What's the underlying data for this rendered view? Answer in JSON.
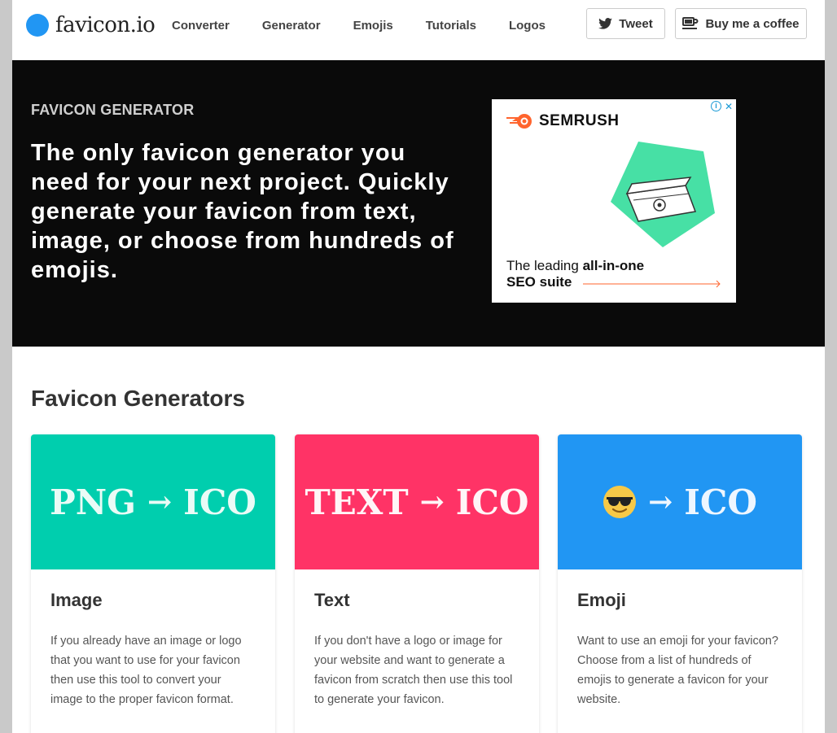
{
  "nav": {
    "logo_text": "favicon.io",
    "links": [
      "Converter",
      "Generator",
      "Emojis",
      "Tutorials",
      "Logos"
    ],
    "tweet_label": "Tweet",
    "coffee_label": "Buy me a coffee"
  },
  "hero": {
    "kicker": "FAVICON GENERATOR",
    "title": "The only favicon generator you need for your next project. Quickly generate your favicon from text, image, or choose from hundreds of emojis."
  },
  "ad": {
    "brand": "SEMRUSH",
    "close": "✕",
    "info": "i",
    "tagline_pre": "The leading ",
    "tagline_bold": "all-in-one",
    "tagline_line2": "SEO suite",
    "colors": {
      "orange": "#ff642d",
      "green": "#47e0a5"
    }
  },
  "section": {
    "title": "Favicon Generators"
  },
  "cards": [
    {
      "banner_left": "PNG",
      "banner_arrow": "→",
      "banner_right": "ICO",
      "color": "#00ceae",
      "title": "Image",
      "desc": "If you already have an image or logo that you want to use for your favicon then use this tool to convert your image to the proper favicon format."
    },
    {
      "banner_left": "TEXT",
      "banner_arrow": "→",
      "banner_right": "ICO",
      "color": "#ff3366",
      "title": "Text",
      "desc": "If you don't have a logo or image for your website and want to generate a favicon from scratch then use this tool to generate your favicon."
    },
    {
      "banner_left": "",
      "banner_arrow": "→",
      "banner_right": "ICO",
      "color": "#2196f3",
      "title": "Emoji",
      "desc": "Want to use an emoji for your favicon? Choose from a list of hundreds of emojis to generate a favicon for your website."
    }
  ]
}
